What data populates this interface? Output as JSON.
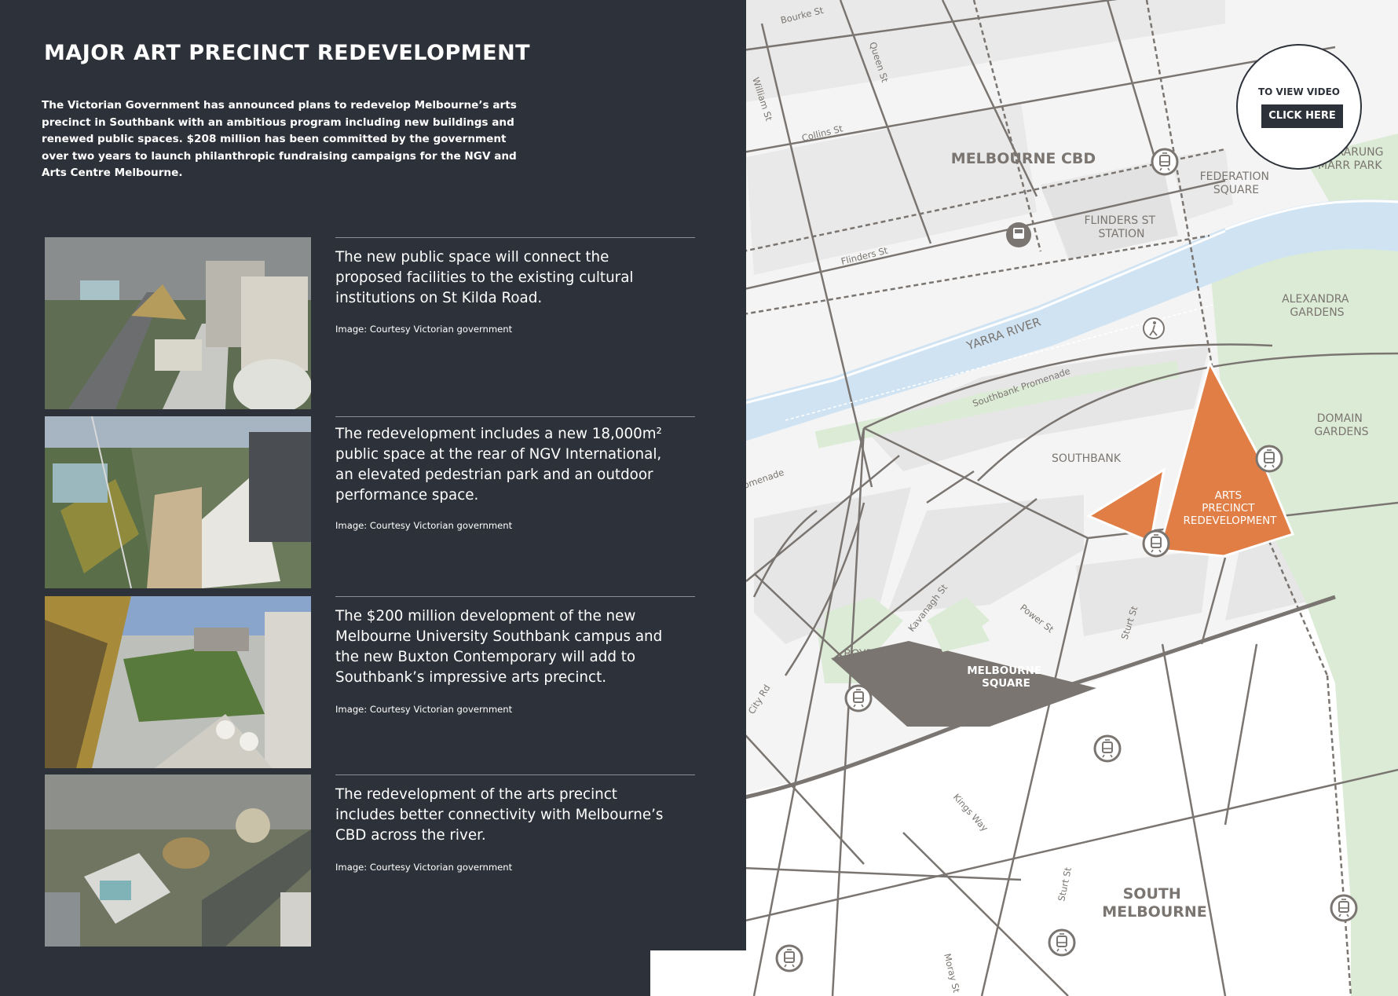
{
  "title": "MAJOR ART PRECINCT REDEVELOPMENT",
  "intro": "The Victorian Government has announced plans to redevelop Melbourne’s arts precinct in Southbank with an ambitious program including new buildings and renewed public spaces. $208 million has been committed by the government over two years to launch philanthropic fundraising campaigns for the NGV and Arts Centre Melbourne.",
  "cards": [
    {
      "description": "The new public space will connect the proposed facilities to the existing cultural institutions on St Kilda Road.",
      "credit": "Image: Courtesy Victorian government"
    },
    {
      "description": "The redevelopment includes a new 18,000m² public space at the rear of NGV International, an elevated pedestrian park and an outdoor performance space.",
      "credit": "Image: Courtesy Victorian government"
    },
    {
      "description": "The $200 million development of the new Melbourne University Southbank campus and the new Buxton Contemporary will add to Southbank’s impressive arts precinct.",
      "credit": "Image: Courtesy Victorian government"
    },
    {
      "description": "The redevelopment of the arts precinct includes better connectivity with Melbourne’s CBD across the river.",
      "credit": "Image: Courtesy Victorian government"
    }
  ],
  "video": {
    "label": "TO VIEW VIDEO",
    "button": "CLICK HERE"
  },
  "map": {
    "areas": {
      "cbd": "MELBOURNE CBD",
      "south_melbourne": [
        "SOUTH",
        "MELBOURNE"
      ],
      "southbank": "SOUTHBANK",
      "federation_square": [
        "FEDERATION",
        "SQUARE"
      ],
      "flinders_station": [
        "FLINDERS ST",
        "STATION"
      ],
      "alexandra_gardens": [
        "ALEXANDRA",
        "GARDENS"
      ],
      "domain_gardens": [
        "DOMAIN",
        "GARDENS"
      ],
      "birrarung_marr": [
        "BIRRARUNG",
        "MARR PARK"
      ],
      "boyd_park": [
        "BOYD",
        "PARK"
      ],
      "arts_precinct": [
        "ARTS",
        "PRECINCT",
        "REDEVELOPMENT"
      ],
      "melbourne_square": [
        "MELBOURNE",
        "SQUARE"
      ]
    },
    "river": "YARRA RIVER",
    "streets": {
      "bourke": "Bourke St",
      "queen": "Queen St",
      "william": "William St",
      "collins": "Collins St",
      "flinders": "Flinders St",
      "southbank_promenade": "Southbank Promenade",
      "promenade_fragment": "omenade",
      "kavanagh": "Kavanagh St",
      "power": "Power St",
      "sturt_north": "Sturt St",
      "sturt_south": "Sturt St",
      "city_rd": "City Rd",
      "kings_way": "Kings Way",
      "moray": "Moray St"
    },
    "icons": [
      "tram-icon",
      "train-icon",
      "pedestrian-icon"
    ],
    "colors": {
      "precinct": "#e07e45",
      "river": "#cfe3f3",
      "parks": "#dcebd6",
      "blocks": "#ececec",
      "melbourne_square": "#7a7570",
      "roads": "#7a7570",
      "panel": "#2d3139"
    }
  }
}
